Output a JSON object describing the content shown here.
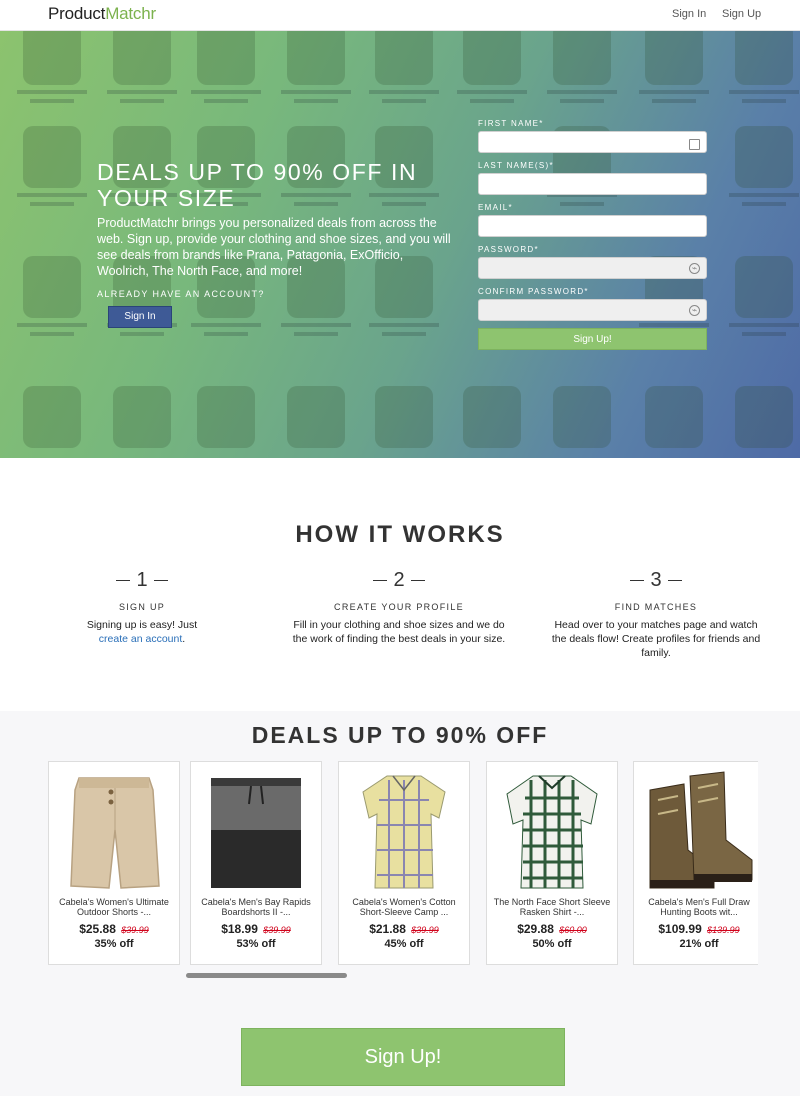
{
  "navbar": {
    "brand_part1": "Product",
    "brand_part2": "Matchr",
    "sign_in": "Sign In",
    "sign_up": "Sign Up"
  },
  "hero": {
    "title": "DEALS UP TO 90% OFF IN YOUR SIZE",
    "description": "ProductMatchr brings you personalized deals from across the web. Sign up, provide your clothing and shoe sizes, and you will see deals from brands like Prana, Patagonia, ExOfficio, Woolrich, The North Face, and more!",
    "already_label": "ALREADY HAVE AN ACCOUNT?",
    "sign_in_button": "Sign In"
  },
  "form": {
    "first_name_label": "FIRST NAME*",
    "last_name_label": "LAST NAME(S)*",
    "email_label": "EMAIL*",
    "password_label": "PASSWORD*",
    "confirm_password_label": "CONFIRM PASSWORD*",
    "submit": "Sign Up!"
  },
  "how_it_works": {
    "title": "HOW IT WORKS",
    "steps": [
      {
        "num": "1",
        "heading": "SIGN UP",
        "text_before": "Signing up is easy! Just ",
        "link": "create an account",
        "text_after": "."
      },
      {
        "num": "2",
        "heading": "CREATE YOUR PROFILE",
        "text": "Fill in your clothing and shoe sizes and we do the work of finding the best deals in your size."
      },
      {
        "num": "3",
        "heading": "FIND MATCHES",
        "text": "Head over to your matches page and watch the deals flow! Create profiles for friends and family."
      }
    ]
  },
  "deals": {
    "title": "DEALS UP TO 90% OFF",
    "items": [
      {
        "name": "Cabela's Women's Ultimate Outdoor Shorts -...",
        "price": "$25.88",
        "old_price": "$39.99",
        "off": "35% off",
        "icon": "shorts-icon"
      },
      {
        "name": "Cabela's Men's Bay Rapids Boardshorts II -...",
        "price": "$18.99",
        "old_price": "$39.99",
        "off": "53% off",
        "icon": "boardshorts-icon"
      },
      {
        "name": "Cabela's Women's Cotton Short-Sleeve Camp ...",
        "price": "$21.88",
        "old_price": "$39.99",
        "off": "45% off",
        "icon": "plaid-shirt-icon"
      },
      {
        "name": "The North Face Short Sleeve Rasken Shirt -...",
        "price": "$29.88",
        "old_price": "$60.00",
        "off": "50% off",
        "icon": "check-shirt-icon"
      },
      {
        "name": "Cabela's Men's Full Draw Hunting Boots wit...",
        "price": "$109.99",
        "old_price": "$139.99",
        "off": "21% off",
        "icon": "boots-icon"
      }
    ],
    "cta": "Sign Up!"
  },
  "colors": {
    "accent_green": "#8ec46f",
    "brand_green": "#7cb24e",
    "sign_in_blue": "#3e5a96",
    "strike_red": "#d0021b"
  }
}
